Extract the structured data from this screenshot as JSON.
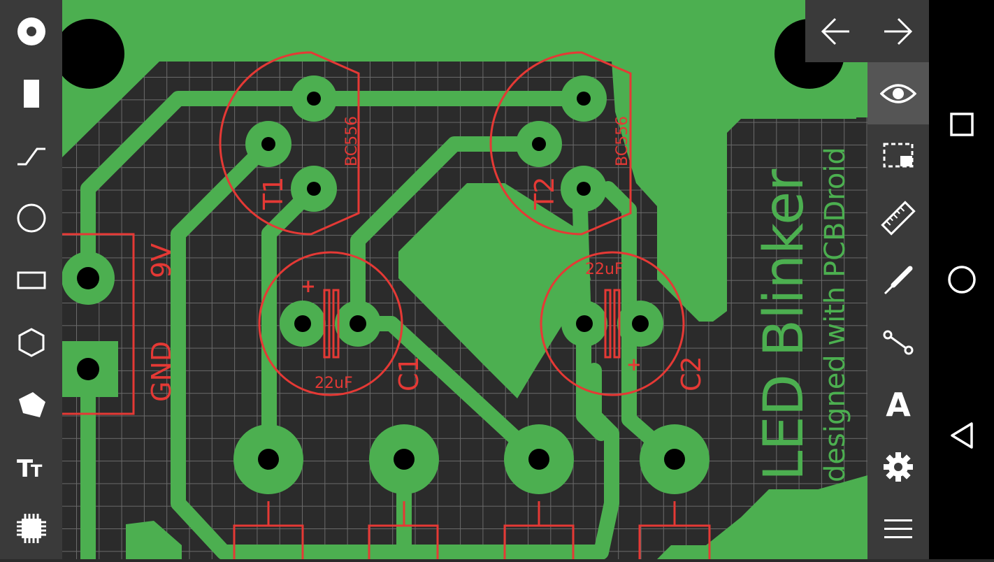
{
  "left_tools": [
    {
      "name": "pad-tool",
      "icon": "pad-icon"
    },
    {
      "name": "smd-pad-tool",
      "icon": "smd-pad-icon"
    },
    {
      "name": "track-tool",
      "icon": "track-icon"
    },
    {
      "name": "circle-tool",
      "icon": "circle-icon"
    },
    {
      "name": "rectangle-tool",
      "icon": "rectangle-icon"
    },
    {
      "name": "polygon-tool",
      "icon": "hexagon-icon"
    },
    {
      "name": "area-tool",
      "icon": "area-icon"
    },
    {
      "name": "text-tool",
      "icon": "text-tool-icon"
    },
    {
      "name": "component-tool",
      "icon": "chip-icon"
    }
  ],
  "right_tools": [
    {
      "name": "view-tool",
      "icon": "eye-icon",
      "active": true
    },
    {
      "name": "select-area-tool",
      "icon": "select-area-icon"
    },
    {
      "name": "measure-tool",
      "icon": "ruler-icon"
    },
    {
      "name": "probe-tool",
      "icon": "probe-icon"
    },
    {
      "name": "connect-tool",
      "icon": "net-connect-icon"
    },
    {
      "name": "text-style-tool",
      "icon": "letter-a-icon",
      "label": "A"
    },
    {
      "name": "settings-tool",
      "icon": "gear-icon"
    },
    {
      "name": "menu-tool",
      "icon": "hamburger-icon"
    }
  ],
  "pcb": {
    "title": "LED Blinker",
    "subtitle": "designed with PCBDroid",
    "labels": {
      "t1": "T1",
      "t2": "T2",
      "t1_part": "BC556",
      "t2_part": "BC556",
      "c1": "C1",
      "c2": "C2",
      "c1_value": "22uF",
      "c2_value": "22uF",
      "c1_plus": "+",
      "c2_plus": "+",
      "v9": "9V",
      "gnd": "GND"
    }
  },
  "colors": {
    "copper": "#4caf50",
    "silkscreen": "#e53935",
    "board": "#2b2b2b",
    "grid": "#6a6a6a",
    "toolbar": "#3a3a3a",
    "icon": "#ffffff"
  }
}
